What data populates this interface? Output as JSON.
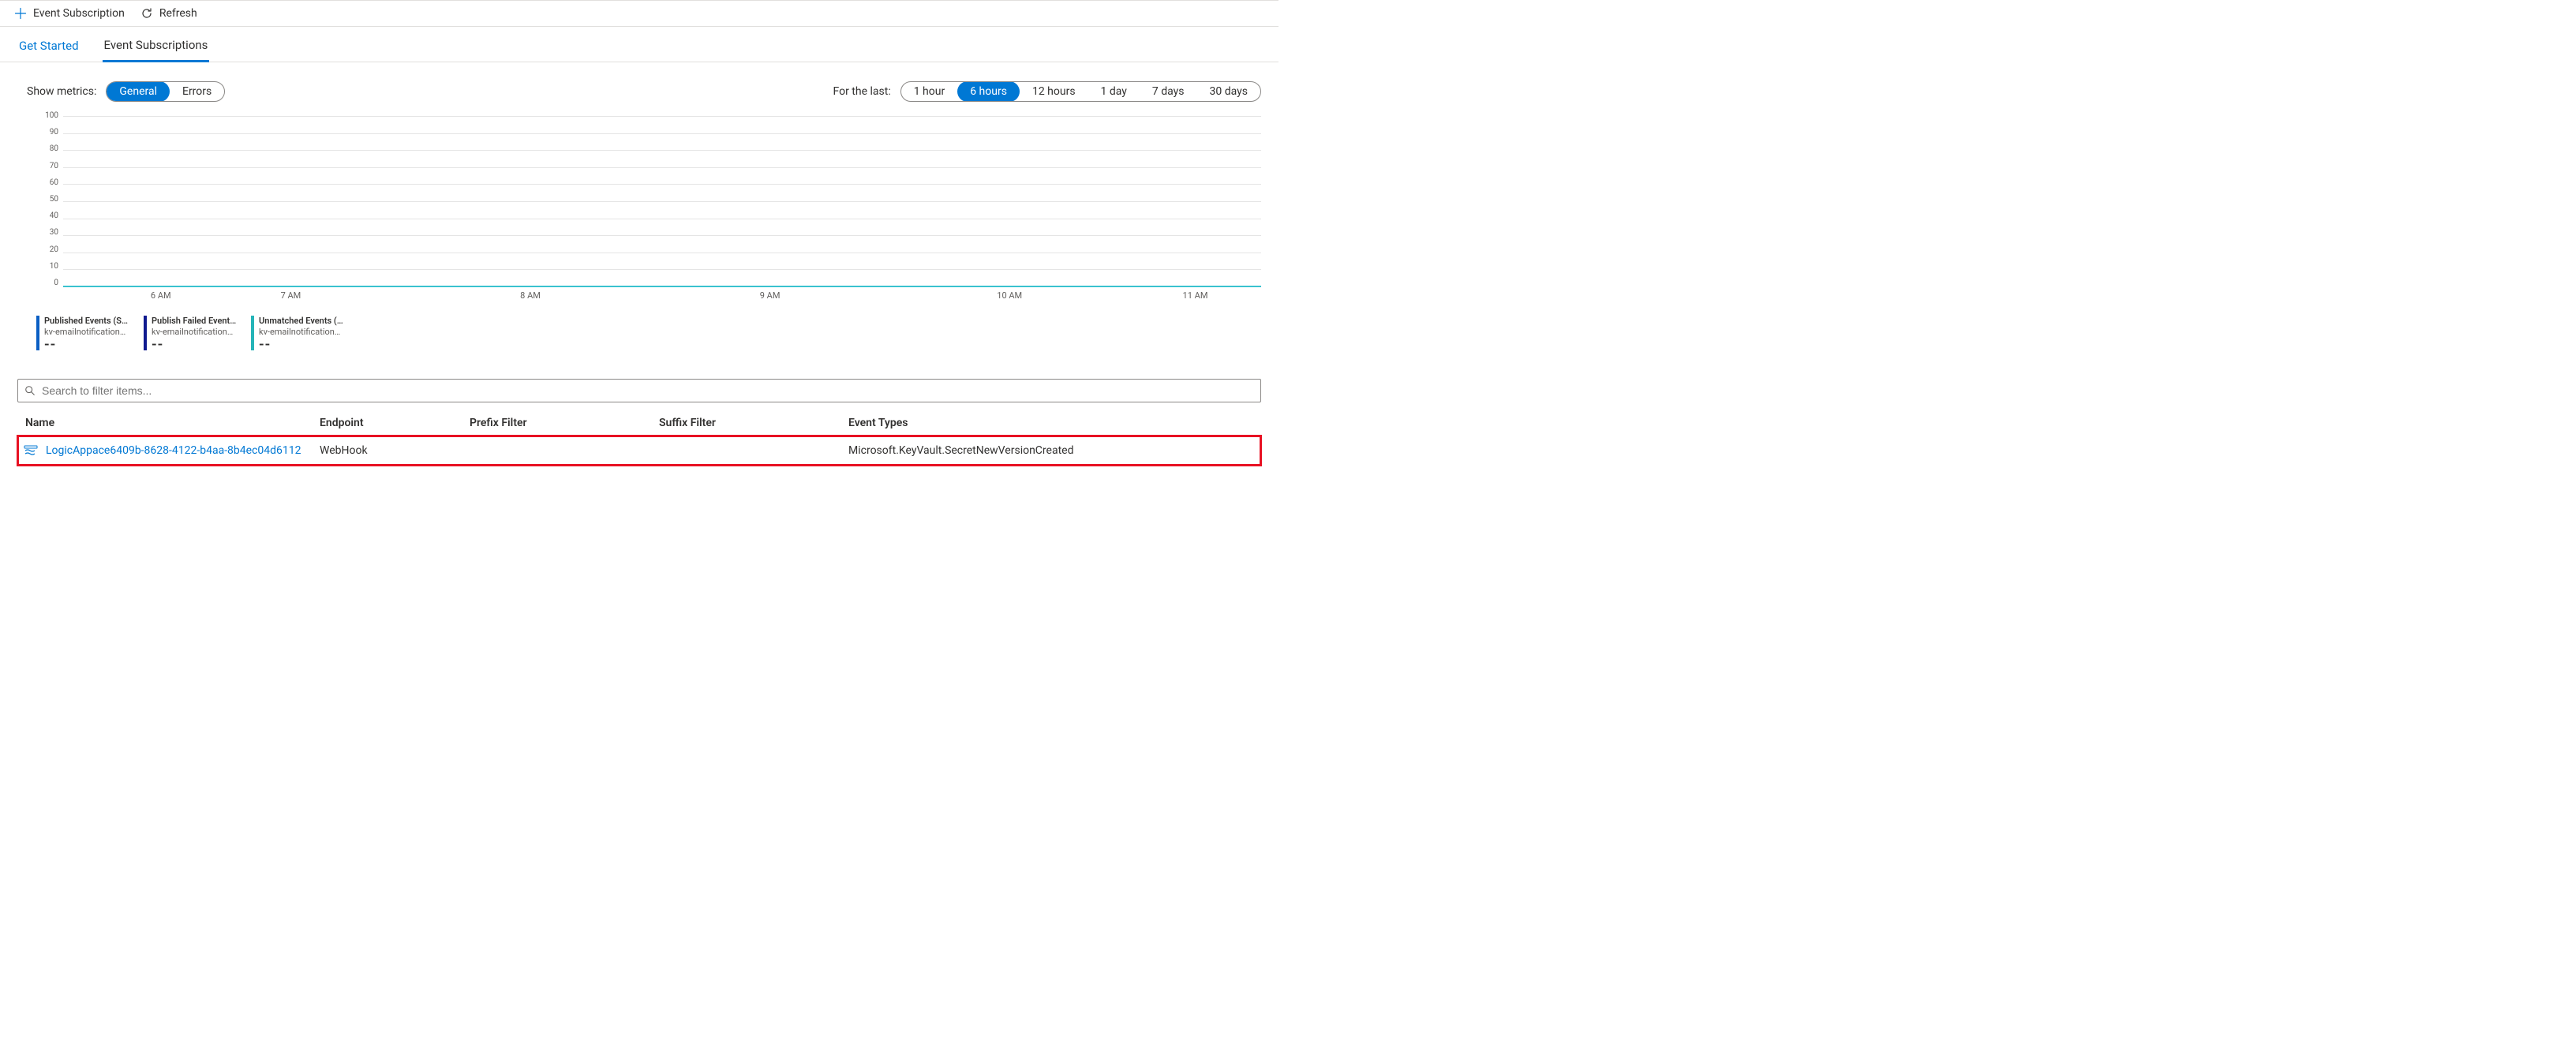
{
  "toolbar": {
    "add_label": "Event Subscription",
    "refresh_label": "Refresh"
  },
  "tabs": {
    "get_started": "Get Started",
    "event_subscriptions": "Event Subscriptions"
  },
  "filters": {
    "metric_label": "Show metrics:",
    "metric_options": [
      "General",
      "Errors"
    ],
    "metric_selected": "General",
    "time_label": "For the last:",
    "time_options": [
      "1 hour",
      "6 hours",
      "12 hours",
      "1 day",
      "7 days",
      "30 days"
    ],
    "time_selected": "6 hours"
  },
  "chart_data": {
    "type": "line",
    "title": "",
    "xlabel": "",
    "ylabel": "",
    "ylim": [
      0,
      100
    ],
    "y_ticks": [
      100,
      90,
      80,
      70,
      60,
      50,
      40,
      30,
      20,
      10,
      0
    ],
    "x_ticks": [
      "6 AM",
      "7 AM",
      "8 AM",
      "9 AM",
      "10 AM",
      "11 AM"
    ],
    "series": [
      {
        "name": "Published Events (Sum)",
        "source": "kv-emailnotification…",
        "value_display": "--",
        "color": "#0b5fc4"
      },
      {
        "name": "Publish Failed Event…",
        "source": "kv-emailnotification…",
        "value_display": "--",
        "color": "#101a8f"
      },
      {
        "name": "Unmatched Events (Sum)",
        "source": "kv-emailnotification…",
        "value_display": "--",
        "color": "#25b4b8"
      }
    ]
  },
  "search": {
    "placeholder": "Search to filter items..."
  },
  "table": {
    "columns": {
      "name": "Name",
      "endpoint": "Endpoint",
      "prefix": "Prefix Filter",
      "suffix": "Suffix Filter",
      "event_types": "Event Types"
    },
    "rows": [
      {
        "name": "LogicAppace6409b-8628-4122-b4aa-8b4ec04d6112",
        "endpoint": "WebHook",
        "prefix": "",
        "suffix": "",
        "event_types": "Microsoft.KeyVault.SecretNewVersionCreated",
        "highlighted": true
      }
    ]
  }
}
